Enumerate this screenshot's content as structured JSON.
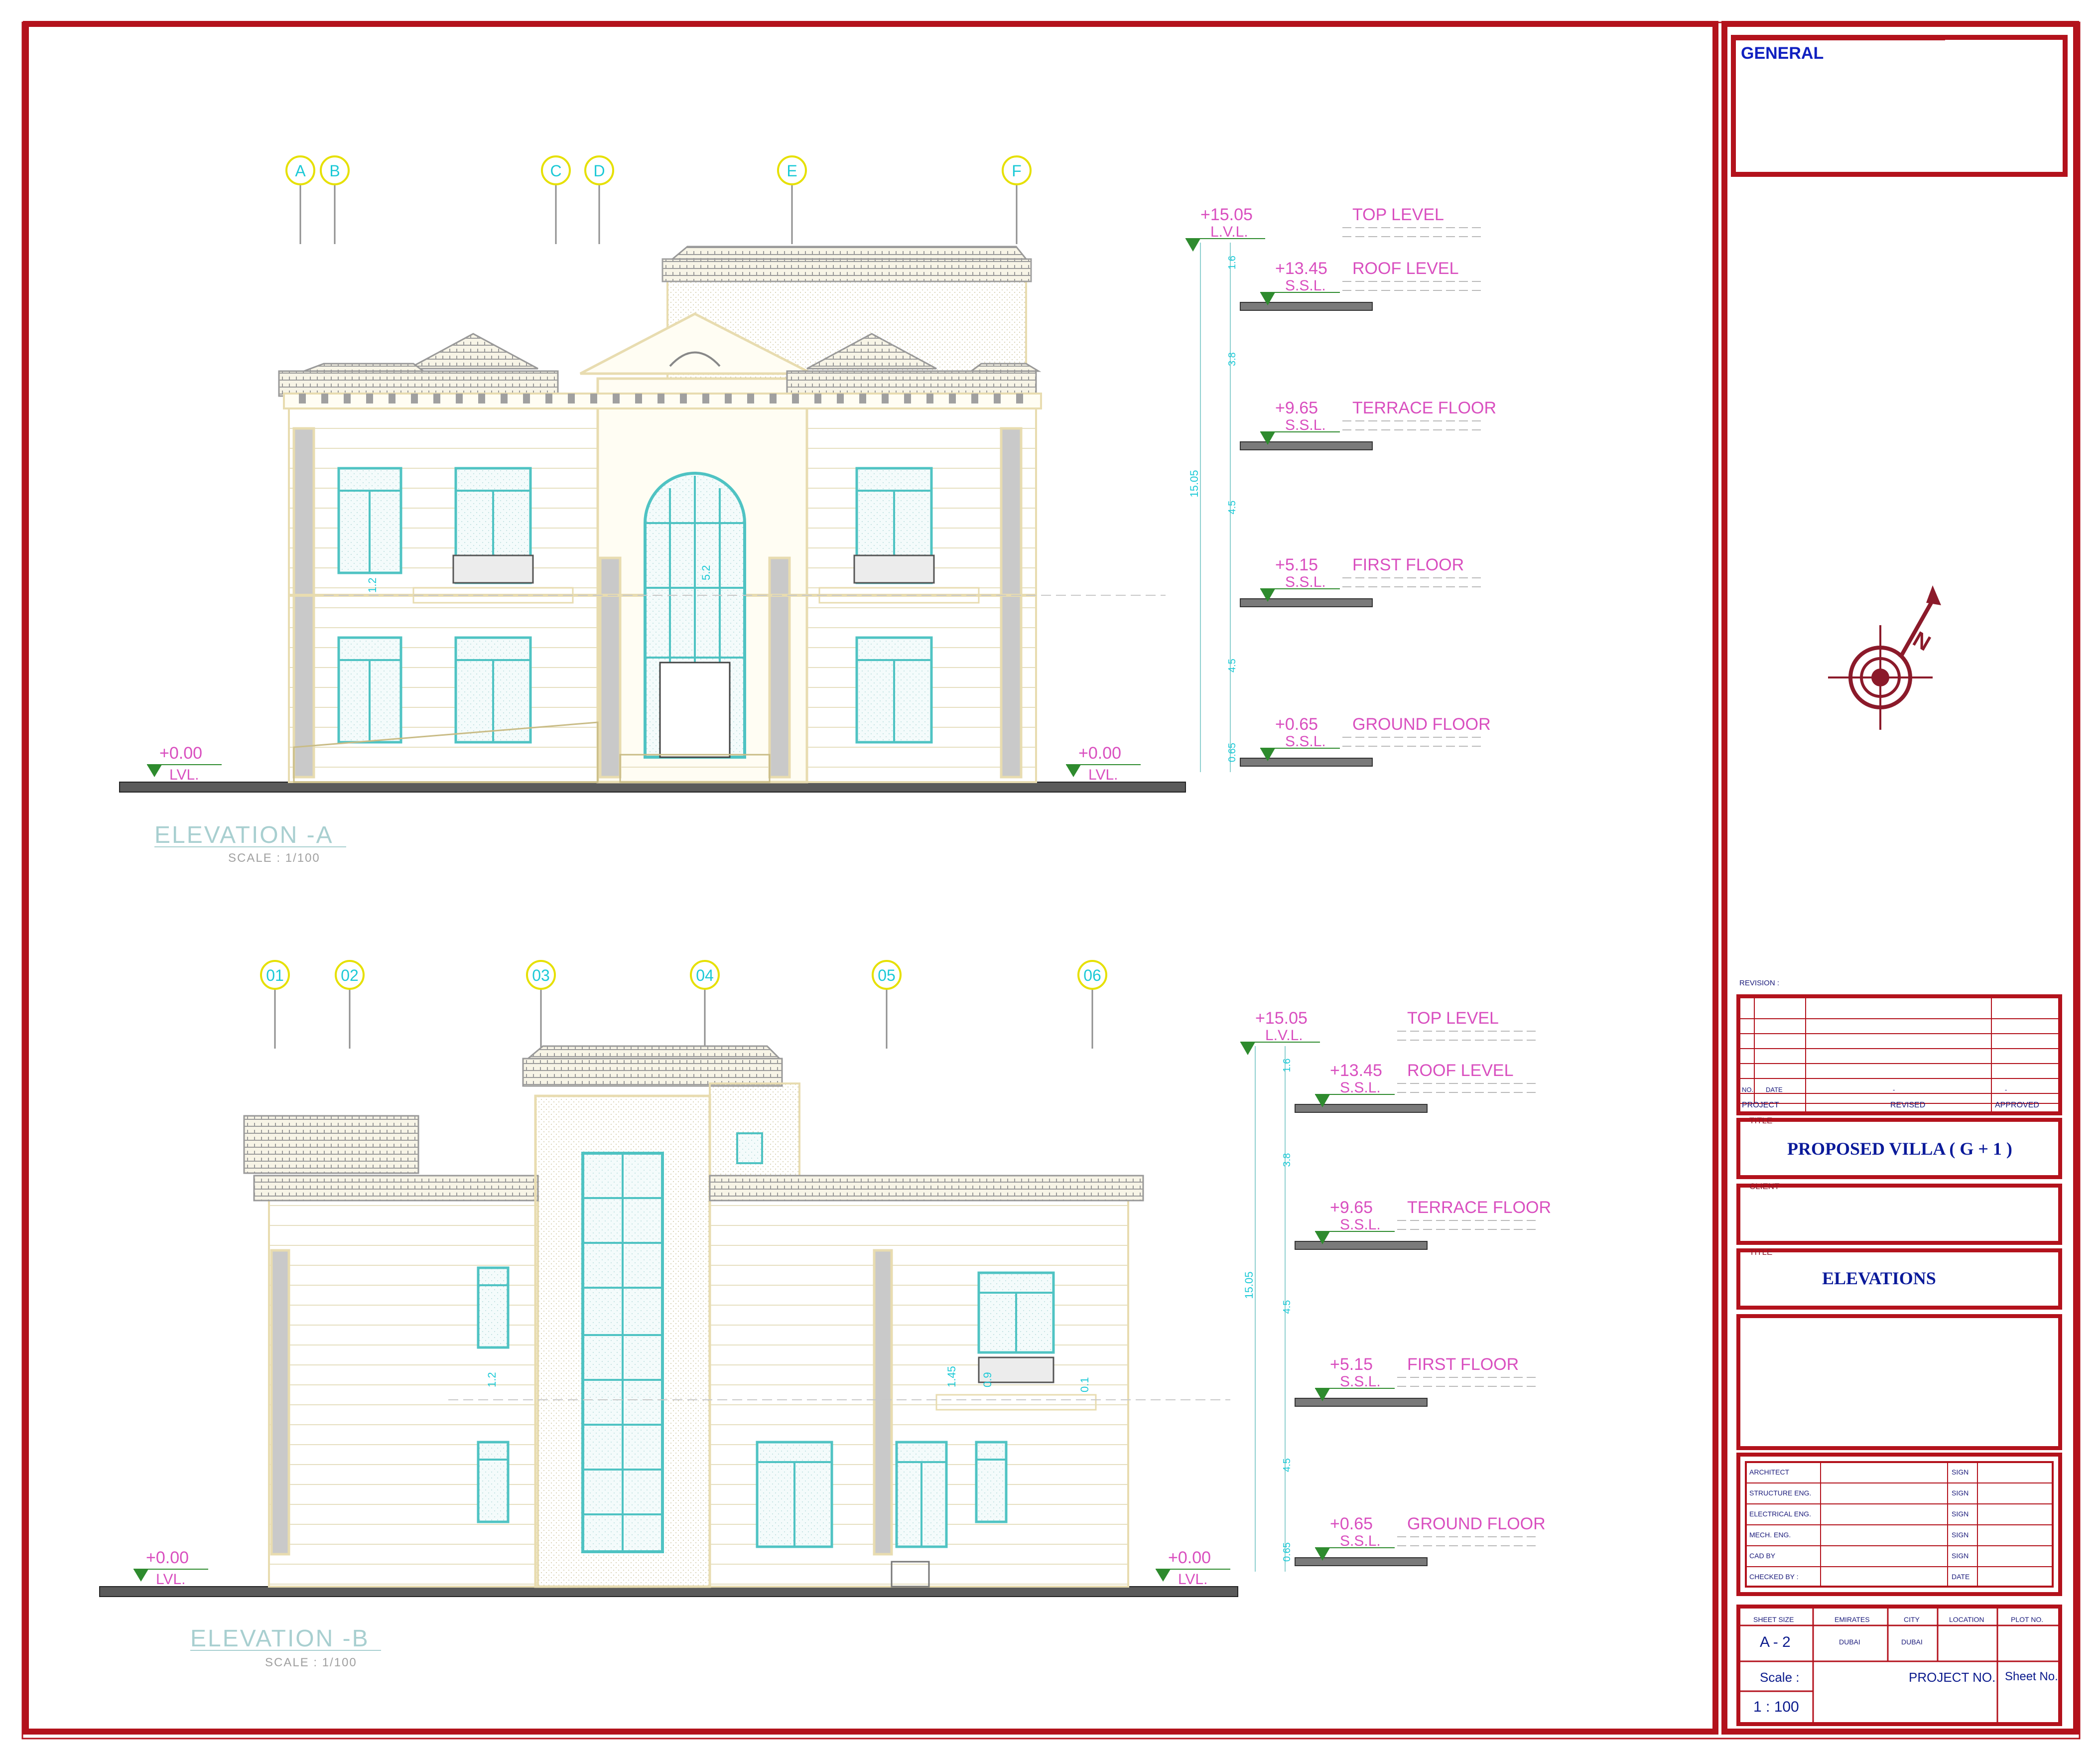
{
  "colors": {
    "frame": "#b3121c",
    "outline": "#e8dcb0",
    "glass": "#4fc3c3",
    "dim": "#d94fbf",
    "grid": "#e6e000",
    "gridtext": "#1bc9d6",
    "ground": "#3a3a3a",
    "tbtext": "#0a1a9a"
  },
  "elevation_a": {
    "title": "ELEVATION  -A",
    "scale": "SCALE : 1/100",
    "grid_labels": [
      "A",
      "B",
      "C",
      "D",
      "E",
      "F"
    ],
    "left_level": {
      "value": "+0.00",
      "tag": "LVL."
    },
    "right_level": {
      "value": "+0.00",
      "tag": "LVL."
    },
    "levels": [
      {
        "value": "+15.05",
        "tag": "L.V.L.",
        "name": "TOP  LEVEL"
      },
      {
        "value": "+13.45",
        "tag": "S.S.L.",
        "name": "ROOF  LEVEL"
      },
      {
        "value": "+9.65",
        "tag": "S.S.L.",
        "name": "TERRACE  FLOOR"
      },
      {
        "value": "+5.15",
        "tag": "S.S.L.",
        "name": "FIRST  FLOOR"
      },
      {
        "value": "+0.65",
        "tag": "S.S.L.",
        "name": "GROUND  FLOOR"
      }
    ],
    "dims": [
      "1.6",
      "3.8",
      "4.5",
      "4.5",
      "0.65",
      "15.05",
      "5.2",
      "1.2"
    ]
  },
  "elevation_b": {
    "title": "ELEVATION  -B",
    "scale": "SCALE : 1/100",
    "grid_labels": [
      "01",
      "02",
      "03",
      "04",
      "05",
      "06"
    ],
    "left_level": {
      "value": "+0.00",
      "tag": "LVL."
    },
    "right_level": {
      "value": "+0.00",
      "tag": "LVL."
    },
    "levels": [
      {
        "value": "+15.05",
        "tag": "L.V.L.",
        "name": "TOP  LEVEL"
      },
      {
        "value": "+13.45",
        "tag": "S.S.L.",
        "name": "ROOF  LEVEL"
      },
      {
        "value": "+9.65",
        "tag": "S.S.L.",
        "name": "TERRACE  FLOOR"
      },
      {
        "value": "+5.15",
        "tag": "S.S.L.",
        "name": "FIRST  FLOOR"
      },
      {
        "value": "+0.65",
        "tag": "S.S.L.",
        "name": "GROUND  FLOOR"
      }
    ],
    "dims": [
      "1.6",
      "3.8",
      "4.5",
      "4.5",
      "0.65",
      "15.05",
      "1.45",
      "0.9",
      "0.1",
      "1.2"
    ]
  },
  "title_block": {
    "general": "GENERAL",
    "revision_label": "REVISION :",
    "rev_no": "NO.",
    "rev_date": "DATE",
    "rev_dash1": "-",
    "rev_dash2": "-",
    "project": "PROJECT",
    "revised": "REVISED",
    "approved": "APPROVED",
    "title_label": "TITLE",
    "project_name": "PROPOSED VILLA   ( G + 1 )",
    "client_label": "CLIENT",
    "title_label2": "TITLE",
    "sheet_title": "ELEVATIONS",
    "sign_rows": [
      {
        "role": "ARCHITECT",
        "right": "SIGN"
      },
      {
        "role": "STRUCTURE ENG.",
        "right": "SIGN"
      },
      {
        "role": "ELECTRICAL ENG.",
        "right": "SIGN"
      },
      {
        "role": "MECH. ENG.",
        "right": "SIGN"
      },
      {
        "role": "CAD BY",
        "right": "SIGN"
      },
      {
        "role": "CHECKED BY :",
        "right": "DATE"
      }
    ],
    "sheet_size_label": "SHEET SIZE",
    "sheet_size": "A - 2",
    "emirates_label": "EMIRATES",
    "emirates": "DUBAI",
    "city_label": "CITY",
    "city": "DUBAI",
    "location_label": "LOCATION",
    "plot_label": "PLOT NO.",
    "scale_label": "Scale :",
    "scale": "1 : 100",
    "project_no": "PROJECT NO.",
    "sheet_no": "Sheet No."
  },
  "north": "N"
}
